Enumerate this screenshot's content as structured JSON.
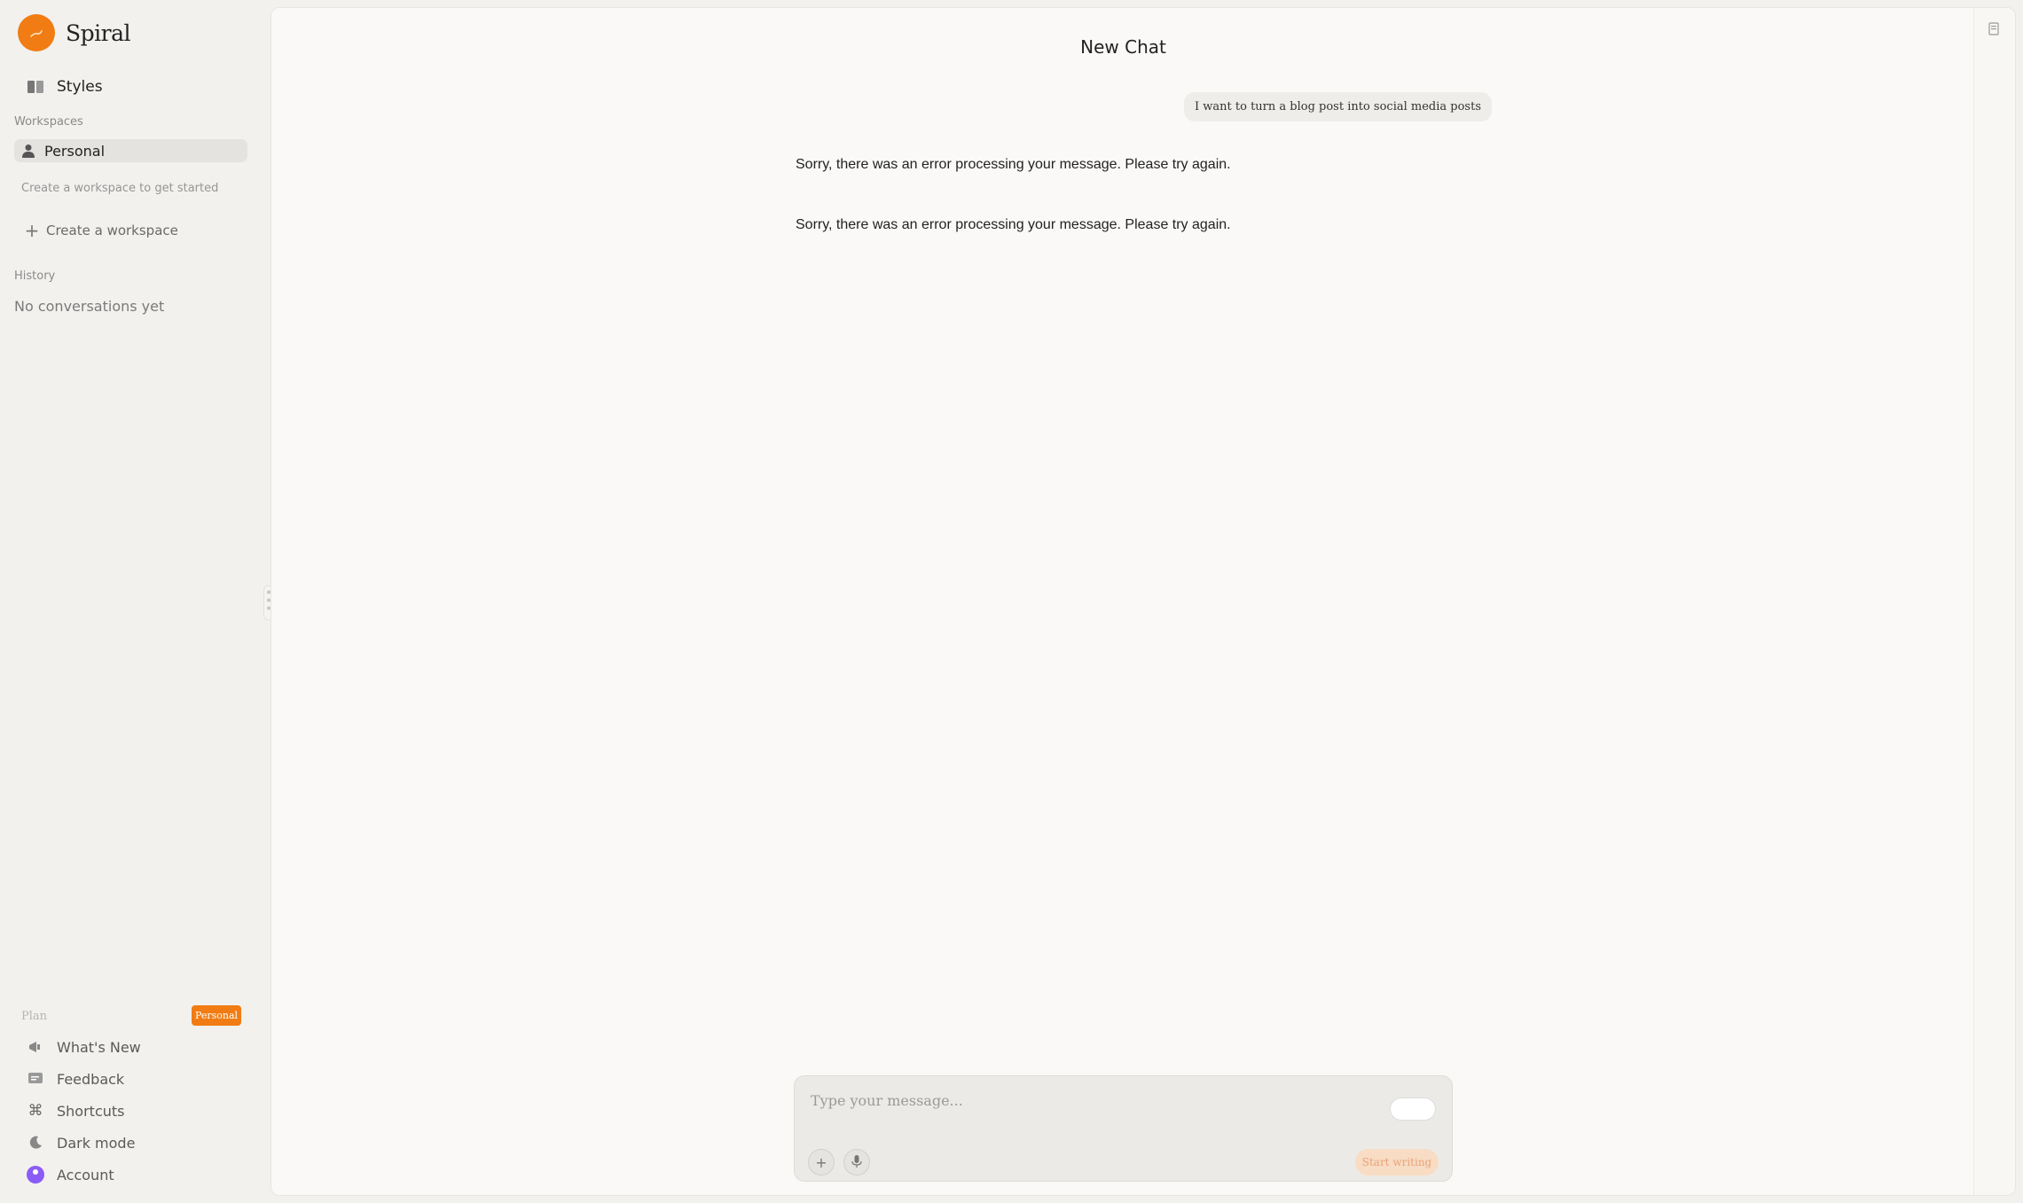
{
  "brand": {
    "name": "Spiral",
    "accent": "#f07c13"
  },
  "sidebar": {
    "styles_label": "Styles",
    "workspaces_heading": "Workspaces",
    "workspace_personal": "Personal",
    "workspace_hint": "Create a workspace to get started",
    "create_workspace": "Create a workspace",
    "history_heading": "History",
    "history_empty": "No conversations yet",
    "plan_label": "Plan",
    "plan_badge": "Personal",
    "bottom": {
      "whats_new": "What's New",
      "feedback": "Feedback",
      "shortcuts": "Shortcuts",
      "dark_mode": "Dark mode",
      "account": "Account"
    }
  },
  "chat": {
    "title": "New Chat",
    "user_message": "I want to turn a blog post into social media posts",
    "ai_messages": [
      "Sorry, there was an error processing your message. Please try again.",
      "Sorry, there was an error processing your message. Please try again."
    ]
  },
  "composer": {
    "placeholder": "Type your message...",
    "send_label": "Start writing"
  }
}
